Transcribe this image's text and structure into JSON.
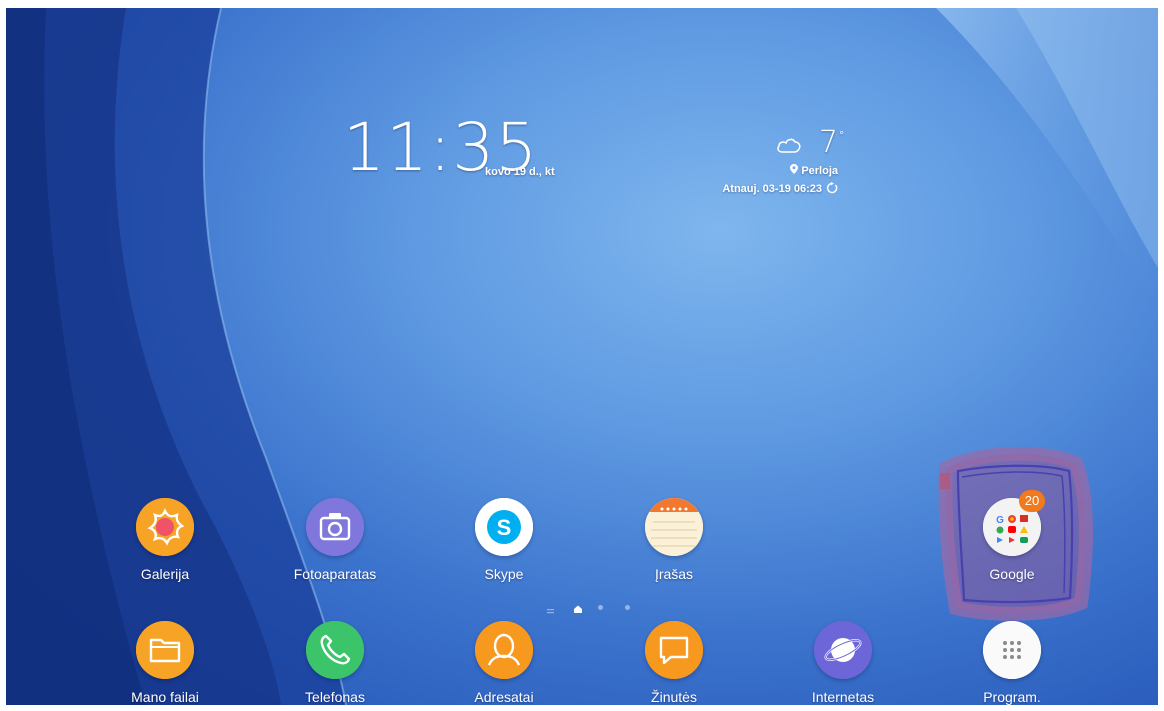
{
  "clock": {
    "time": "11:35",
    "date": "kovo 19 d., kt"
  },
  "weather": {
    "temperature": "7",
    "degree": "°",
    "icon": "cloud-icon",
    "location": "Perloja",
    "updated": "Atnauj. 03-19 06:23"
  },
  "apps_row1": [
    {
      "label": "Galerija",
      "icon": "gallery-icon",
      "color": "#f79a1e"
    },
    {
      "label": "Fotoaparatas",
      "icon": "camera-icon",
      "color": "#7a6fd6"
    },
    {
      "label": "Skype",
      "icon": "skype-icon",
      "color": "#ffffff"
    },
    {
      "label": "Įrašas",
      "icon": "notes-icon",
      "color": "#fbeecf"
    },
    {
      "label": "Google",
      "icon": "google-folder-icon",
      "color": "#f2f2f2",
      "badge": "20"
    }
  ],
  "apps_dock": [
    {
      "label": "Mano failai",
      "icon": "folder-icon",
      "color": "#f79a1e"
    },
    {
      "label": "Telefonas",
      "icon": "phone-icon",
      "color": "#3ec46d"
    },
    {
      "label": "Adresatai",
      "icon": "contacts-icon",
      "color": "#f7941d"
    },
    {
      "label": "Žinutės",
      "icon": "messages-icon",
      "color": "#f7941d"
    },
    {
      "label": "Internetas",
      "icon": "internet-icon",
      "color": "#6a63d6"
    },
    {
      "label": "Program.",
      "icon": "apps-grid-icon",
      "color": "#ffffff"
    }
  ],
  "page_indicator": {
    "current": 2,
    "total": 4
  }
}
